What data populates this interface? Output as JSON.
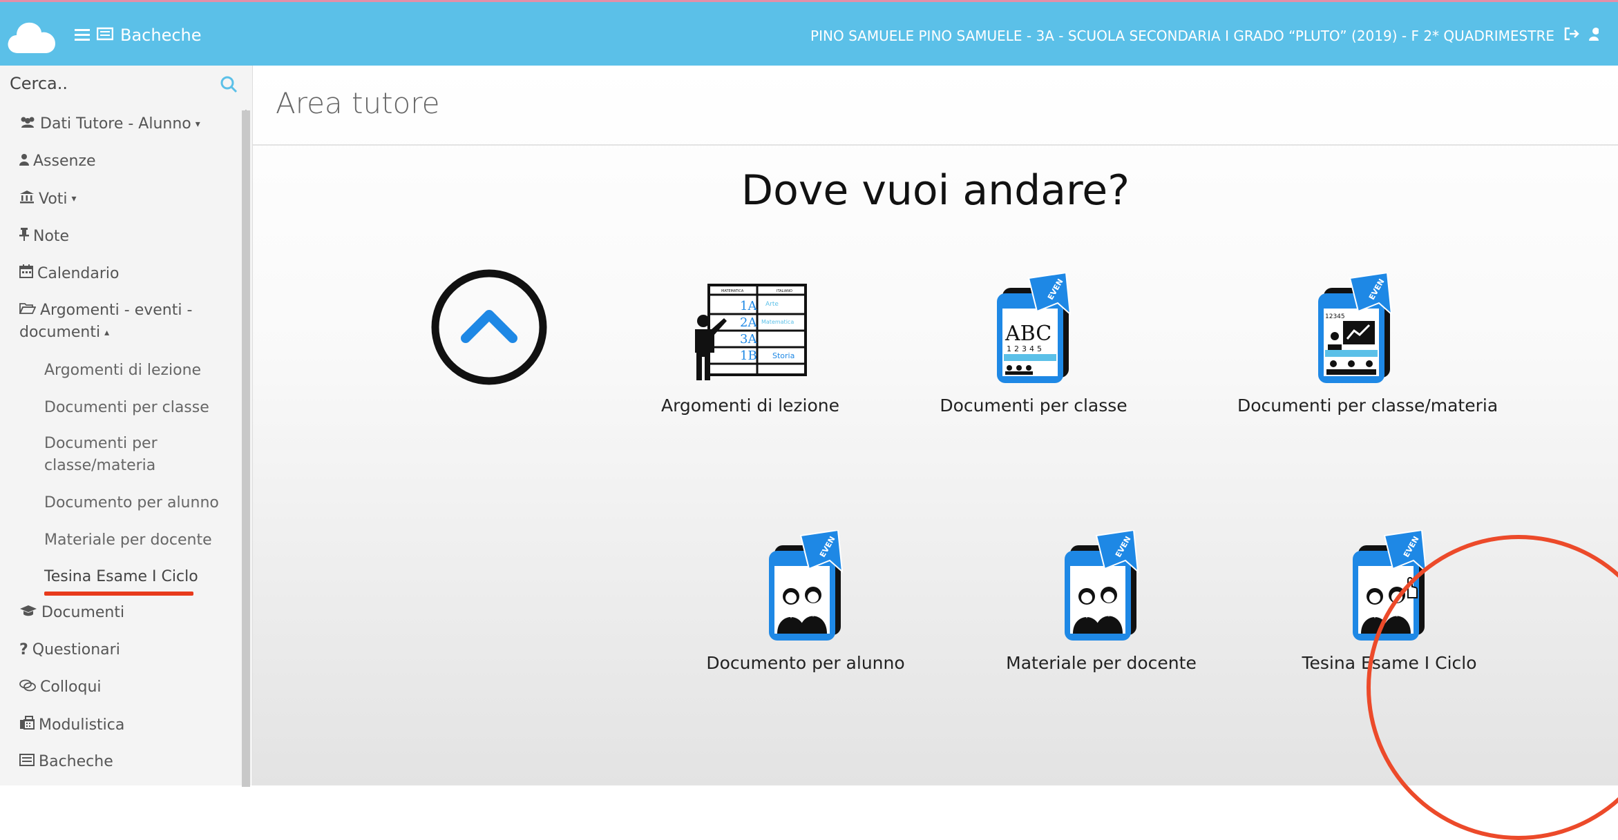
{
  "header": {
    "nav_label": "Bacheche",
    "user_text": "PINO SAMUELE  PINO SAMUELE - 3A - SCUOLA SECONDARIA I GRADO “PLUTO” (2019) - F  2* QUADRIMESTRE"
  },
  "sidebar": {
    "search_placeholder": "Cerca..",
    "items": [
      {
        "label": "Dati Tutore - Alunno",
        "caret": "▾"
      },
      {
        "label": "Assenze"
      },
      {
        "label": "Voti",
        "caret": "▾"
      },
      {
        "label": "Note"
      },
      {
        "label": "Calendario"
      },
      {
        "label": "Argomenti - eventi -",
        "label2": "documenti",
        "caret": "▴"
      },
      {
        "label": "Documenti"
      },
      {
        "label": "Questionari"
      },
      {
        "label": "Colloqui"
      },
      {
        "label": "Modulistica"
      },
      {
        "label": "Bacheche"
      }
    ],
    "subitems": [
      {
        "label": "Argomenti di lezione"
      },
      {
        "label": "Documenti per classe"
      },
      {
        "label": "Documenti per",
        "label2": "classe/materia"
      },
      {
        "label": "Documento per alunno"
      },
      {
        "label": "Materiale per docente"
      },
      {
        "label": "Tesina Esame I Ciclo"
      }
    ]
  },
  "main": {
    "page_title": "Area tutore",
    "heading": "Dove vuoi andare?",
    "tiles": [
      {
        "label": "Argomenti di lezione",
        "icon": "blackboard-teacher-icon",
        "board_rows": [
          "1A",
          "2A",
          "3A",
          "1B"
        ],
        "board_cols": [
          "MATEMATICA",
          "ITALIANO"
        ],
        "board_text": [
          "Arte",
          "Matematica",
          "Storia"
        ]
      },
      {
        "label": "Documenti per classe",
        "icon": "tablet-abc-icon",
        "tag": "EVEN",
        "abc": "ABC",
        "nums": "12345"
      },
      {
        "label": "Documenti per classe/materia",
        "icon": "tablet-class-icon",
        "tag": "EVEN",
        "nums": "12345"
      },
      {
        "label": "Documento per alunno",
        "icon": "tablet-students-icon",
        "tag": "EVEN"
      },
      {
        "label": "Materiale per docente",
        "icon": "tablet-students-icon",
        "tag": "EVEN"
      },
      {
        "label": "Tesina Esame I Ciclo",
        "icon": "tablet-students-icon",
        "tag": "EVEN"
      }
    ]
  },
  "colors": {
    "topbar": "#5bc0e8",
    "accent": "#1e88e5",
    "annotation": "#ec4a2a"
  }
}
